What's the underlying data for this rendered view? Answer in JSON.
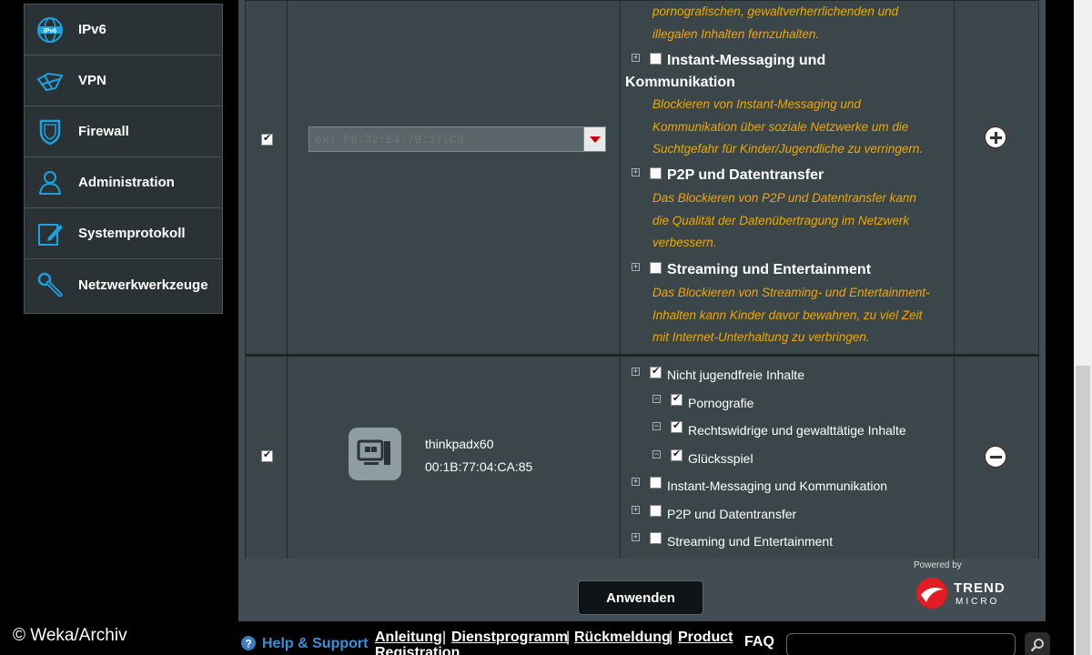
{
  "sidebar": {
    "items": [
      {
        "label": "IPv6",
        "icon": "ipv6-globe-icon"
      },
      {
        "label": "VPN",
        "icon": "vpn-icon"
      },
      {
        "label": "Firewall",
        "icon": "shield-icon"
      },
      {
        "label": "Administration",
        "icon": "user-icon"
      },
      {
        "label": "Systemprotokoll",
        "icon": "log-edit-icon"
      },
      {
        "label": "Netzwerkwerkzeuge",
        "icon": "wrench-icon"
      }
    ]
  },
  "row1": {
    "enabled": true,
    "mac_placeholder": "ex: F8:32:E4:79:17:C8",
    "categories": [
      {
        "desc_lines": [
          "pornografischen, gewaltverherrlichenden und",
          "illegalen Inhalten fernzuhalten."
        ]
      },
      {
        "title_line1": "Instant-Messaging und",
        "title_line2": "Kommunikation",
        "desc_lines": [
          "Blockieren von Instant-Messaging und",
          "Kommunikation über soziale Netzwerke um die",
          "Suchtgefahr für Kinder/Jugendliche zu verringern."
        ]
      },
      {
        "title": "P2P und Datentransfer",
        "desc_lines": [
          "Das Blockieren von P2P und Datentransfer kann",
          "die Qualität der Datenübertragung im Netzwerk",
          "verbessern."
        ]
      },
      {
        "title": "Streaming und Entertainment",
        "desc_lines": [
          "Das Blockieren von Streaming- und Entertainment-",
          "Inhalten kann Kinder davor bewahren, zu viel Zeit",
          "mit Internet-Unterhaltung zu verbringen."
        ]
      }
    ],
    "action": "add"
  },
  "row2": {
    "enabled": true,
    "device_name": "thinkpadx60",
    "device_mac": "00:1B:77:04:CA:85",
    "filters": [
      {
        "label": "Nicht jugendfreie Inhalte",
        "checked": true,
        "level": 0
      },
      {
        "label": "Pornografie",
        "checked": true,
        "level": 1
      },
      {
        "label": "Rechtswidrige und gewalttätige Inhalte",
        "checked": true,
        "level": 1
      },
      {
        "label": "Glücksspiel",
        "checked": true,
        "level": 1
      },
      {
        "label": "Instant-Messaging und Kommunikation",
        "checked": false,
        "level": 0
      },
      {
        "label": "P2P und Datentransfer",
        "checked": false,
        "level": 0
      },
      {
        "label": "Streaming und Entertainment",
        "checked": false,
        "level": 0
      }
    ],
    "action": "remove"
  },
  "apply_label": "Anwenden",
  "trend": {
    "powered_by": "Powered by",
    "brand1": "TREND",
    "brand2": "MICRO"
  },
  "footer": {
    "help": "Help & Support",
    "link1": "Anleitung",
    "link2": "Dienstprogramm",
    "link3": "Rückmeldung",
    "link4": "Product",
    "link4b": "Registration",
    "faq": "FAQ",
    "sep": "|"
  },
  "watermark": "© Weka/Archiv",
  "colors": {
    "accent_orange": "#f0a800",
    "panel": "#3a464a",
    "icon_blue": "#1aa3e0"
  }
}
